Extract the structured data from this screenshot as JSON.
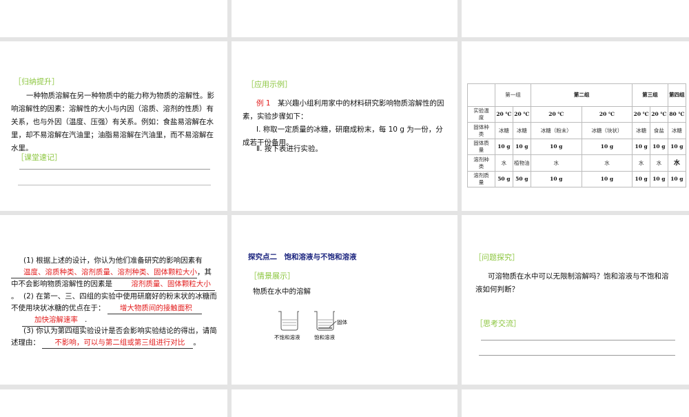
{
  "slide_induction": {
    "heading": "［归纳提升］",
    "paragraph": "一种物质溶解在另一种物质中的能力称为物质的溶解性。影响溶解性的因素：溶解性的大小与内因（溶质、溶剂的性质）有关系，也与外因（温度、压强）有关系。例如：食盐易溶解在水里，却不易溶解在汽油里；油脂易溶解在汽油里，而不易溶解在水里。",
    "notes_heading": "［课堂速记］"
  },
  "slide_example": {
    "heading": "［应用示例］",
    "example_label": "例 1",
    "intro": "某兴趣小组利用家中的材料研究影响物质溶解性的因素，实验步骤如下：",
    "step1": "Ⅰ. 称取一定质量的冰糖，研磨成粉末，每 10 g 为一份，分成若干份备用。",
    "step2": "Ⅱ. 按下表进行实验。"
  },
  "slide_table": {
    "groups": [
      "第一组",
      "第二组",
      "第三组",
      "第四组"
    ],
    "rows": [
      {
        "label": "实验温度",
        "cells": [
          "20 ℃",
          "20 ℃",
          "20 ℃",
          "20 ℃",
          "20 ℃",
          "20 ℃",
          "80 ℃"
        ]
      },
      {
        "label": "固体种类",
        "cells": [
          "冰糖",
          "冰糖",
          "冰糖（粉末）",
          "冰糖（块状）",
          "冰糖",
          "食盐",
          "冰糖"
        ]
      },
      {
        "label": "固体质量",
        "cells": [
          "10 g",
          "10 g",
          "10 g",
          "10 g",
          "10 g",
          "10 g",
          "10 g"
        ]
      },
      {
        "label": "溶剂种类",
        "cells": [
          "水",
          "植物油",
          "水",
          "水",
          "水",
          "水",
          "水"
        ]
      },
      {
        "label": "溶剂质量",
        "cells": [
          "50 g",
          "50 g",
          "10 g",
          "10 g",
          "10 g",
          "10 g",
          "10 g"
        ]
      }
    ]
  },
  "slide_questions": {
    "q1_a": "(1) 根据上述的设计，你认为他们准备研究的影响因素有",
    "q1_ans1": "温度、溶质种类、溶剂质量、溶剂种类、固体颗粒大小",
    "q1_b": "，其中不会影响物质溶解性的因素是",
    "q1_ans2": "溶剂质量、固体颗粒大小",
    "q2": "(2) 在第一、三、四组的实验中使用研磨好的粉末状的冰糖而不使用块状冰糖的优点在于：",
    "q2_ans1": "增大物质间的接触面积",
    "q2_ans2": "加快溶解速率",
    "q3": "(3) 你认为第四组实验设计是否会影响实验结论的得出，请简述理由：",
    "q3_ans": "不影响，可以与第二组或第三组进行对比",
    "period": "。",
    "dot": "."
  },
  "slide_explore": {
    "title": "探究点二　饱和溶液与不饱和溶液",
    "heading": "［情景展示］",
    "caption": "物质在水中的溶解",
    "beaker1": "不饱和溶液",
    "beaker2": "饱和溶液",
    "solid_label": "固体"
  },
  "slide_inquiry": {
    "heading": "［问题探究］",
    "question": "可溶物质在水中可以无限制溶解吗？饱和溶液与不饱和溶液如何判断？",
    "discuss_heading": "［思考交流］"
  }
}
